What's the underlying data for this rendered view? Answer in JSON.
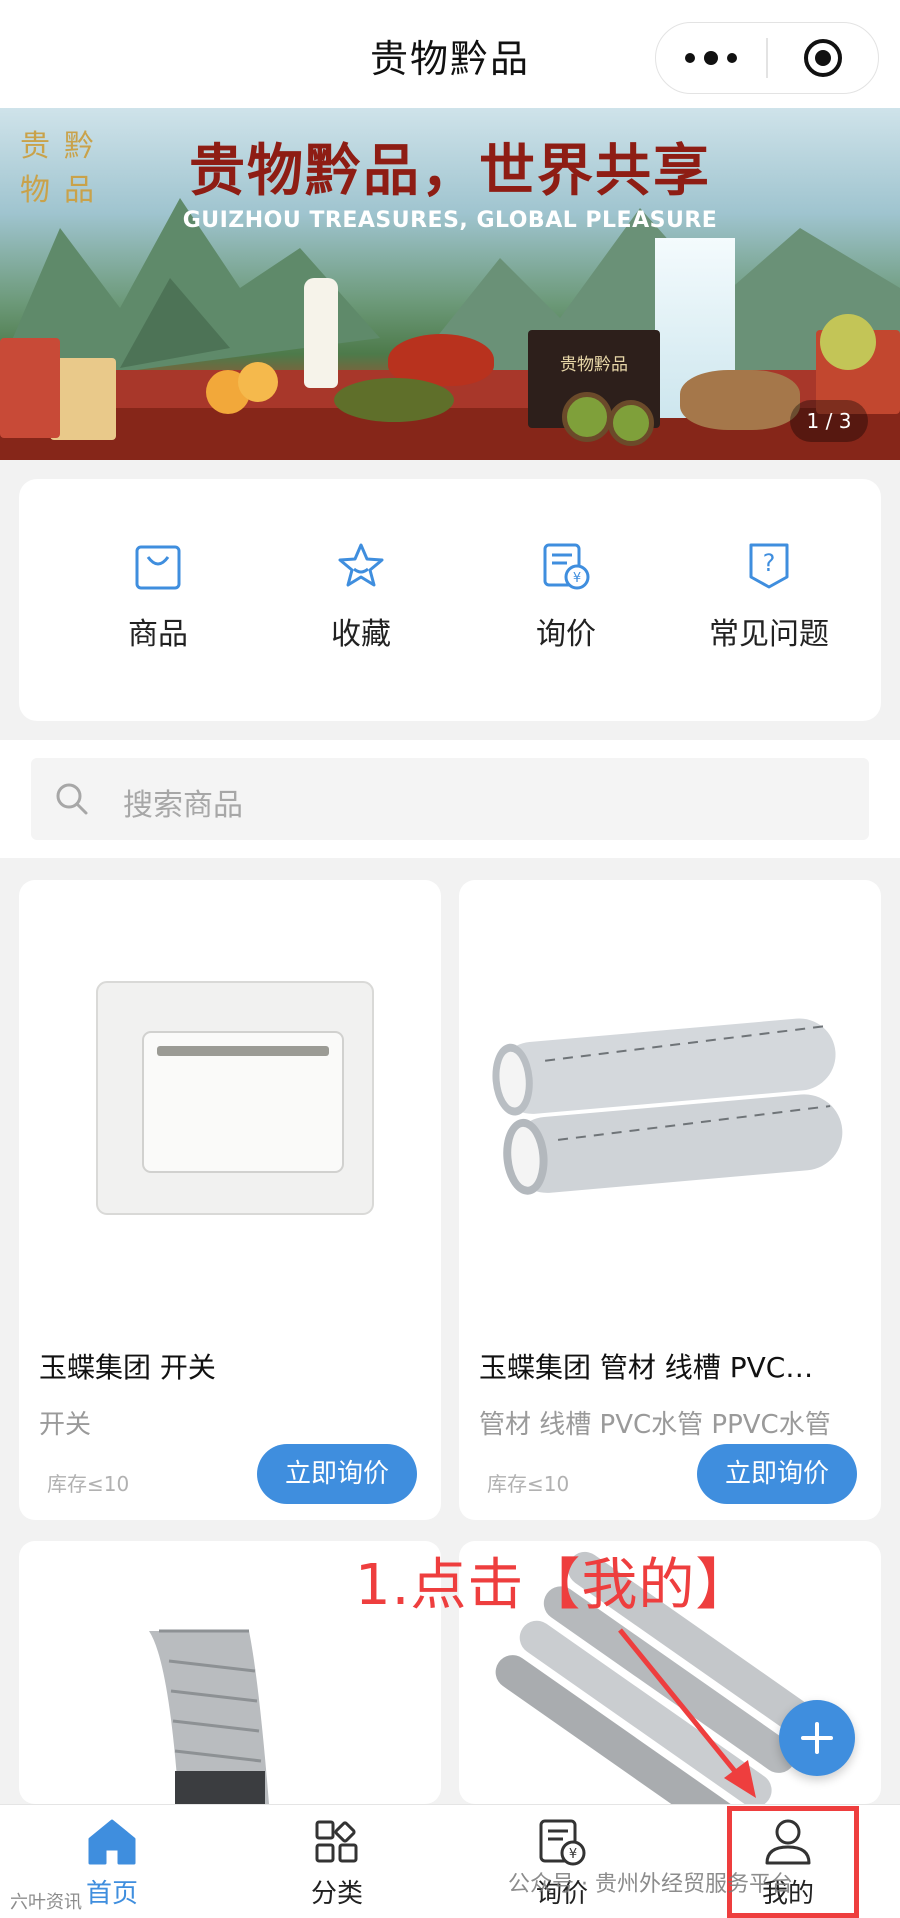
{
  "header": {
    "title": "贵物黔品"
  },
  "banner": {
    "logo_text": "贵黔物品",
    "slogan": "贵物黔品，世界共享",
    "subslogan": "GUIZHOU TREASURES, GLOBAL PLEASURE",
    "box_label": "贵物黔品",
    "counter": "1 / 3"
  },
  "quicknav": [
    {
      "label": "商品",
      "icon": "shopping-bag-icon"
    },
    {
      "label": "收藏",
      "icon": "star-icon"
    },
    {
      "label": "询价",
      "icon": "inquiry-document-icon"
    },
    {
      "label": "常见问题",
      "icon": "faq-icon"
    }
  ],
  "search": {
    "placeholder": "搜索商品"
  },
  "products": [
    {
      "name": "玉蝶集团 开关",
      "subtitle": "开关",
      "stock": "库存≤10",
      "button": "立即询价"
    },
    {
      "name": "玉蝶集团 管材 线槽 PVC…",
      "subtitle": "管材 线槽 PVC水管 PPVC水管",
      "stock": "库存≤10",
      "button": "立即询价"
    }
  ],
  "annotation": {
    "text": "1.点击【我的】"
  },
  "tabbar": [
    {
      "label": "首页",
      "icon": "home-icon",
      "active": true
    },
    {
      "label": "分类",
      "icon": "category-grid-icon",
      "active": false
    },
    {
      "label": "询价",
      "icon": "inquiry-document-icon",
      "active": false
    },
    {
      "label": "我的",
      "icon": "user-icon",
      "active": false
    }
  ],
  "watermark": {
    "text": "公众号 · 贵州外经贸服务平台",
    "left_text": "六叶资讯"
  },
  "colors": {
    "accent": "#3f8ede",
    "annotation_red": "#ee3e3e",
    "background": "#f2f2f2"
  }
}
